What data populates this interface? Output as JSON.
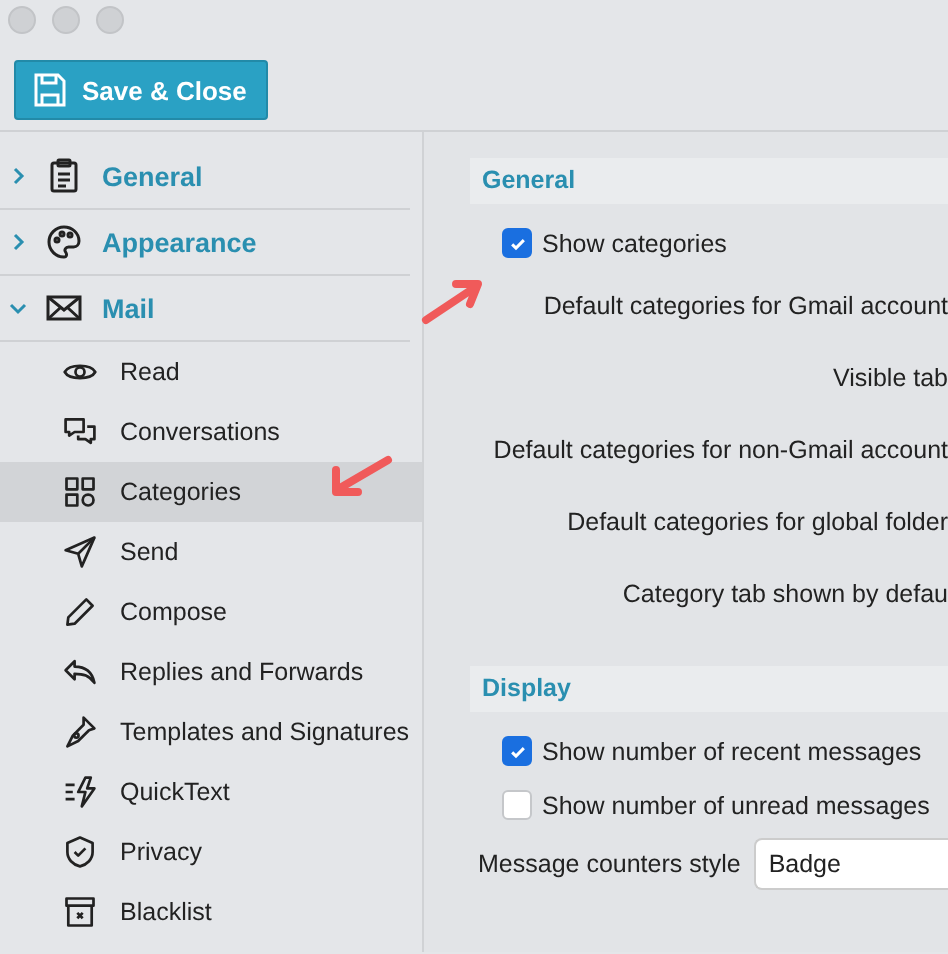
{
  "toolbar": {
    "save_button": "Save & Close"
  },
  "sidebar": {
    "items": [
      {
        "label": "General",
        "expanded": false
      },
      {
        "label": "Appearance",
        "expanded": false
      },
      {
        "label": "Mail",
        "expanded": true,
        "children": [
          {
            "label": "Read",
            "selected": false
          },
          {
            "label": "Conversations",
            "selected": false
          },
          {
            "label": "Categories",
            "selected": true
          },
          {
            "label": "Send",
            "selected": false
          },
          {
            "label": "Compose",
            "selected": false
          },
          {
            "label": "Replies and Forwards",
            "selected": false
          },
          {
            "label": "Templates and Signatures",
            "selected": false
          },
          {
            "label": "QuickText",
            "selected": false
          },
          {
            "label": "Privacy",
            "selected": false
          },
          {
            "label": "Blacklist",
            "selected": false
          }
        ]
      }
    ]
  },
  "sections": [
    {
      "title": "General",
      "rows": [
        {
          "kind": "checkbox",
          "label": "Show categories",
          "checked": true
        },
        {
          "kind": "label",
          "label": "Default categories for Gmail account"
        },
        {
          "kind": "label",
          "label": "Visible tab"
        },
        {
          "kind": "label",
          "label": "Default categories for non-Gmail account"
        },
        {
          "kind": "label",
          "label": "Default categories for global folder"
        },
        {
          "kind": "label",
          "label": "Category tab shown by defau"
        }
      ]
    },
    {
      "title": "Display",
      "rows": [
        {
          "kind": "checkbox",
          "label": "Show number of recent messages",
          "checked": true
        },
        {
          "kind": "checkbox",
          "label": "Show number of unread messages",
          "checked": false
        },
        {
          "kind": "select",
          "label": "Message counters style",
          "value": "Badge"
        }
      ]
    }
  ]
}
